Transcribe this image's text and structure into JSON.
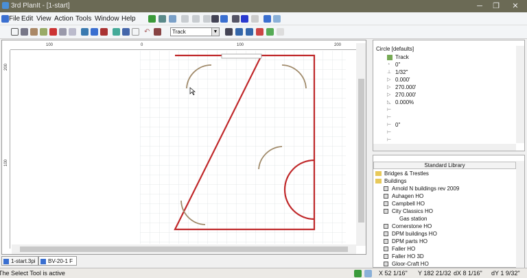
{
  "window": {
    "title": "3rd PlanIt - [1-start]",
    "minimize": "─",
    "restore": "❐",
    "close": "✕"
  },
  "menu": [
    "File",
    "Edit",
    "View",
    "Action",
    "Tools",
    "Window",
    "Help"
  ],
  "toolbar": {
    "track_select": "Track"
  },
  "ruler": {
    "top": [
      "100",
      "0",
      "100",
      "200"
    ],
    "left": [
      "200",
      "100"
    ]
  },
  "doc_tabs": [
    "1-start.3pi",
    "BV-20-1 F"
  ],
  "properties": {
    "title": "Circle [defaults]",
    "rows": [
      {
        "icon": "track-icon",
        "value": "Track"
      },
      {
        "icon": "rotation-icon",
        "value": "0\""
      },
      {
        "icon": "elevation-icon",
        "value": "1/32\""
      },
      {
        "icon": "angle-start-icon",
        "value": "0.000'"
      },
      {
        "icon": "angle-end-icon",
        "value": "270.000'"
      },
      {
        "icon": "angle-sweep-icon",
        "value": "270.000'"
      },
      {
        "icon": "grade-icon",
        "value": "0.000%"
      },
      {
        "icon": "axis-icon",
        "value": ""
      },
      {
        "icon": "axis-icon",
        "value": ""
      },
      {
        "icon": "axis-icon",
        "value": "0\""
      },
      {
        "icon": "axis-icon",
        "value": ""
      },
      {
        "icon": "axis-icon",
        "value": ""
      }
    ]
  },
  "library": {
    "title": "Standard Library",
    "folders": [
      "Bridges & Trestles",
      "Buildings"
    ],
    "items": [
      {
        "label": "Arnold N buildings rev 2009",
        "indent": 1
      },
      {
        "label": "Auhagen HO",
        "indent": 1
      },
      {
        "label": "Campbell HO",
        "indent": 1
      },
      {
        "label": "City Classics HO",
        "indent": 1
      },
      {
        "label": "Gas station",
        "indent": 2
      },
      {
        "label": "Cornerstone HO",
        "indent": 1
      },
      {
        "label": "DPM buildings HO",
        "indent": 1
      },
      {
        "label": "DPM parts HO",
        "indent": 1
      },
      {
        "label": "Faller HO",
        "indent": 1
      },
      {
        "label": "Faller HO 3D",
        "indent": 1
      },
      {
        "label": "Gloor-Craft HO",
        "indent": 1
      }
    ]
  },
  "status": {
    "message": "The Select Tool is active",
    "x": "X 52 1/16\"",
    "y": "Y 182 21/32",
    "dx": "dX 8 1/16\"",
    "dy": "dY 1 9/32\""
  },
  "colors": {
    "wall": "#c0282a",
    "track": "#a08a6a",
    "grid": "#d8dde0"
  }
}
